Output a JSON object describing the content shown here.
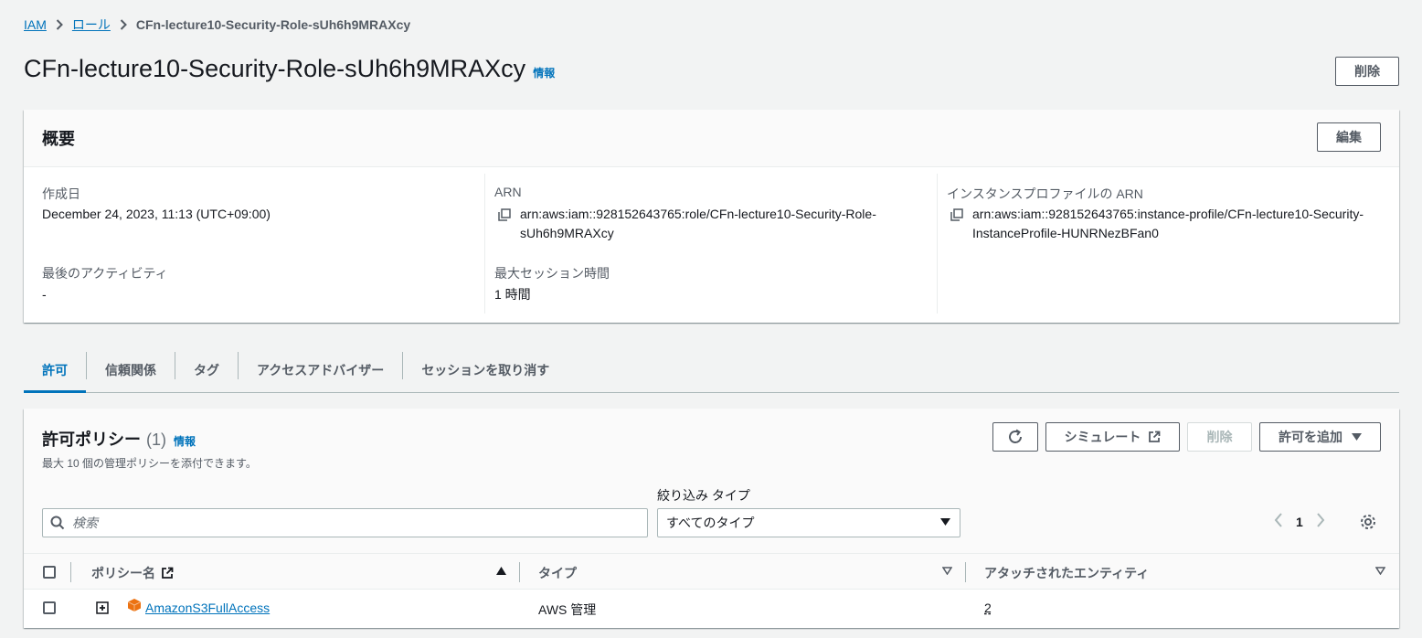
{
  "breadcrumb": {
    "iam": "IAM",
    "roles": "ロール",
    "current": "CFn-lecture10-Security-Role-sUh6h9MRAXcy"
  },
  "header": {
    "title": "CFn-lecture10-Security-Role-sUh6h9MRAXcy",
    "info": "情報",
    "delete_label": "削除"
  },
  "summary": {
    "title": "概要",
    "edit_label": "編集",
    "created_label": "作成日",
    "created_value": "December 24, 2023, 11:13 (UTC+09:00)",
    "last_activity_label": "最後のアクティビティ",
    "last_activity_value": "-",
    "arn_label": "ARN",
    "arn_line1": "arn:aws:iam::928152643765:role/CFn-lecture10-Security-Role-",
    "arn_line2": "sUh6h9MRAXcy",
    "max_session_label": "最大セッション時間",
    "max_session_value": "1 時間",
    "instance_profile_label": "インスタンスプロファイルの ARN",
    "instance_profile_line1": "arn:aws:iam::928152643765:instance-profile/CFn-lecture10-Security-",
    "instance_profile_line2": "InstanceProfile-HUNRNezBFan0"
  },
  "tabs": [
    {
      "label": "許可",
      "active": true
    },
    {
      "label": "信頼関係"
    },
    {
      "label": "タグ"
    },
    {
      "label": "アクセスアドバイザー"
    },
    {
      "label": "セッションを取り消す"
    }
  ],
  "policies": {
    "title": "許可ポリシー",
    "count": "(1)",
    "info": "情報",
    "description": "最大 10 個の管理ポリシーを添付できます。",
    "simulate_label": "シミュレート",
    "delete_label": "削除",
    "add_label": "許可を追加",
    "search_placeholder": "検索",
    "filter_label": "絞り込み タイプ",
    "filter_value": "すべてのタイプ",
    "page": "1",
    "columns": {
      "name": "ポリシー名",
      "type": "タイプ",
      "entities": "アタッチされたエンティティ"
    },
    "rows": [
      {
        "name": "AmazonS3FullAccess",
        "type": "AWS 管理",
        "entities": "2"
      }
    ]
  },
  "colors": {
    "accent": "#0073bb",
    "background": "#f2f3f3",
    "aws_orange": "#ec7211"
  }
}
